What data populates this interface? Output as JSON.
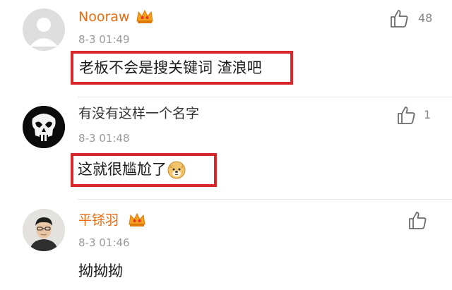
{
  "comments": [
    {
      "username": "Nooraw",
      "vip": true,
      "time": "8-3 01:49",
      "text": "老板不会是搜关键词 渣浪吧",
      "likes": "48",
      "highlighted": true,
      "avatar": "default-avatar"
    },
    {
      "username": "有没有这样一个名字",
      "vip": false,
      "time": "8-3 01:48",
      "text": "这就很尴尬了",
      "emoji": "doge-emoji",
      "likes": "1",
      "highlighted": true,
      "avatar": "skull-avatar"
    },
    {
      "username": "平铩羽",
      "vip": true,
      "time": "8-3 01:46",
      "text": "拗拗拗",
      "likes": "",
      "highlighted": false,
      "avatar": "photo-avatar"
    }
  ],
  "colors": {
    "vip_name": "#e86b10",
    "highlight_border": "#d8282a",
    "time": "#9a9a9a"
  }
}
